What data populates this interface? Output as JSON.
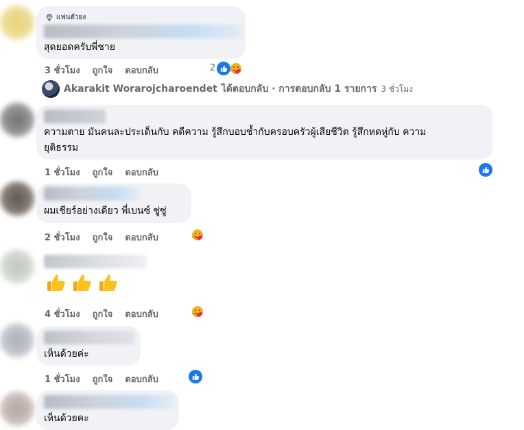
{
  "comments": [
    {
      "badge": "แฟนตัวยง",
      "text": "สุดยอดครับพี่ชาย",
      "time": "3 ชั่วโมง",
      "like": "ถูกใจ",
      "reply": "ตอบกลับ",
      "reaction_count": "2",
      "reactions": [
        "like-icon",
        "care-icon"
      ]
    },
    {
      "text_line1": "ความตาย มันคนละประเด็นกับ คดีความ รู้สึกบอบช้ำกับครอบครัวผู้เสียชีวิต รู้สึกหดหู่กับ ความ",
      "text_line2": "ยุติธรรม",
      "time": "1 ชั่วโมง",
      "like": "ถูกใจ",
      "reply": "ตอบกลับ",
      "reactions": [
        "like-icon"
      ]
    },
    {
      "text": "ผมเชียร์อย่างเดียว พี่เบนซ์ ซู่ซู่",
      "time": "2 ชั่วโมง",
      "like": "ถูกใจ",
      "reply": "ตอบกลับ",
      "reactions": [
        "care-icon"
      ]
    },
    {
      "emoji": [
        "thumbs-up",
        "thumbs-up",
        "thumbs-up"
      ],
      "time": "4 ชั่วโมง",
      "like": "ถูกใจ",
      "reply": "ตอบกลับ",
      "reactions": [
        "care-icon"
      ]
    },
    {
      "text": "เห็นด้วยค่ะ",
      "time": "1 ชั่วโมง",
      "like": "ถูกใจ",
      "reply": "ตอบกลับ",
      "reactions": [
        "like-icon"
      ]
    },
    {
      "text": "เห็นด้วยคะ"
    }
  ],
  "reply_summary": {
    "name": "Akarakit Worarojcharoendet",
    "action": "ได้ตอบกลับ · การตอบกลับ 1 รายการ",
    "time": "3 ชั่วโมง"
  },
  "colors": {
    "bubble": "#f0f2f5",
    "like_blue": "#1877f2",
    "meta_gray": "#65676b"
  }
}
